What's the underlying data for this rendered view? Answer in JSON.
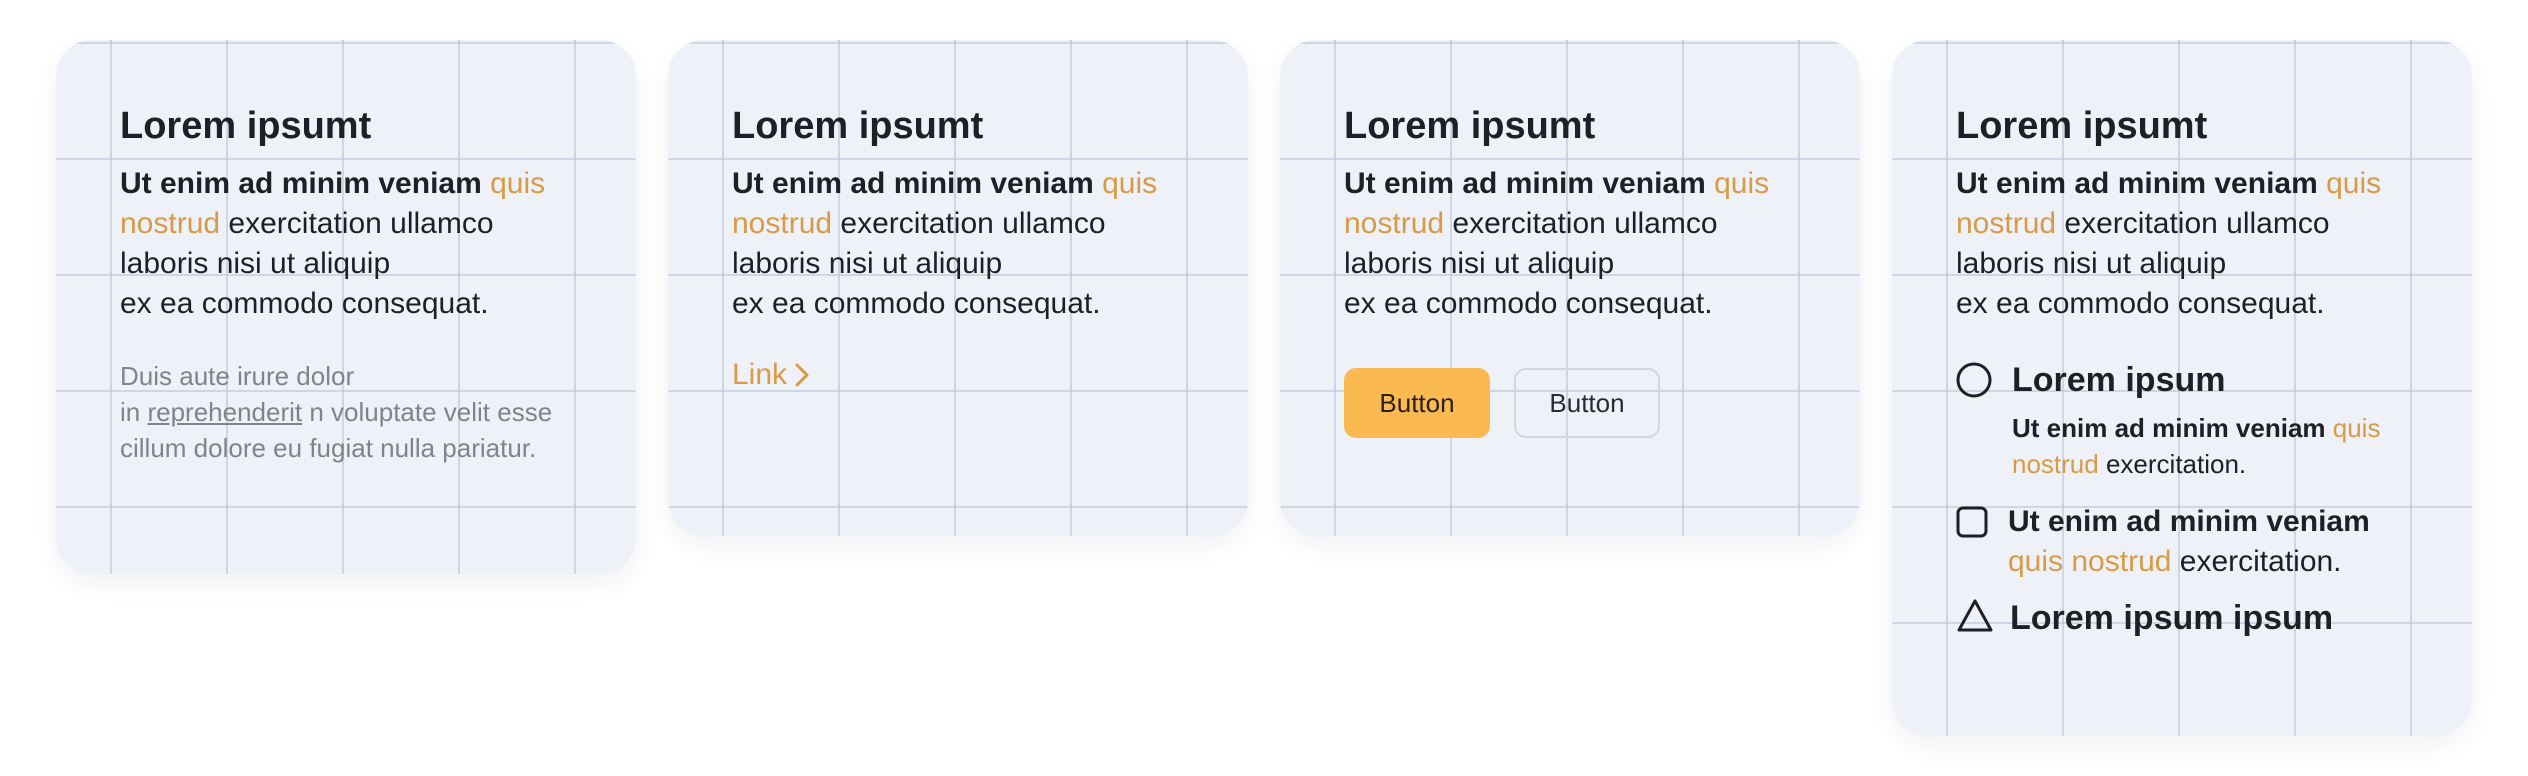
{
  "cards": [
    {
      "title": "Lorem ipsumt",
      "lead": {
        "bold": "Ut enim ad minim veniam ",
        "accent": "quis nostrud",
        "rest1": " exercitation ullamco",
        "rest2": "laboris nisi ut aliquip",
        "rest3": "ex ea commodo consequat."
      },
      "muted": {
        "line1": "Duis aute irure dolor",
        "pre": "in ",
        "underlined": "reprehenderit",
        "post": " n voluptate velit esse cillum dolore eu fugiat nulla pariatur."
      }
    },
    {
      "title": "Lorem ipsumt",
      "lead": {
        "bold": "Ut enim ad minim veniam ",
        "accent": "quis nostrud",
        "rest1": " exercitation ullamco",
        "rest2": "laboris nisi ut aliquip",
        "rest3": "ex ea commodo consequat."
      },
      "link_label": "Link"
    },
    {
      "title": "Lorem ipsumt",
      "lead": {
        "bold": "Ut enim ad minim veniam ",
        "accent": "quis nostrud",
        "rest1": " exercitation ullamco",
        "rest2": "laboris nisi ut aliquip",
        "rest3": "ex ea commodo consequat."
      },
      "primary_button": "Button",
      "secondary_button": "Button"
    },
    {
      "title": "Lorem ipsumt",
      "lead": {
        "bold": "Ut enim ad minim veniam ",
        "accent": "quis nostrud",
        "rest1": " exercitation ullamco",
        "rest2": "laboris nisi ut aliquip",
        "rest3": "ex ea commodo consequat."
      },
      "list": [
        {
          "icon": "circle-icon",
          "title": "Lorem ipsum",
          "desc_bold": "Ut enim ad minim veniam ",
          "desc_accent": "quis nostrud",
          "desc_rest": " exercitation."
        },
        {
          "icon": "square-icon",
          "title": "Ut enim ad minim veniam",
          "desc_accent": "quis nostrud",
          "desc_rest": " exercitation."
        },
        {
          "icon": "triangle-icon",
          "title": "Lorem ipsum ipsum"
        }
      ]
    }
  ],
  "colors": {
    "accent": "#d99a45",
    "button_primary": "#fbb952",
    "card_bg": "#eef1f8",
    "muted_text": "#808389"
  }
}
